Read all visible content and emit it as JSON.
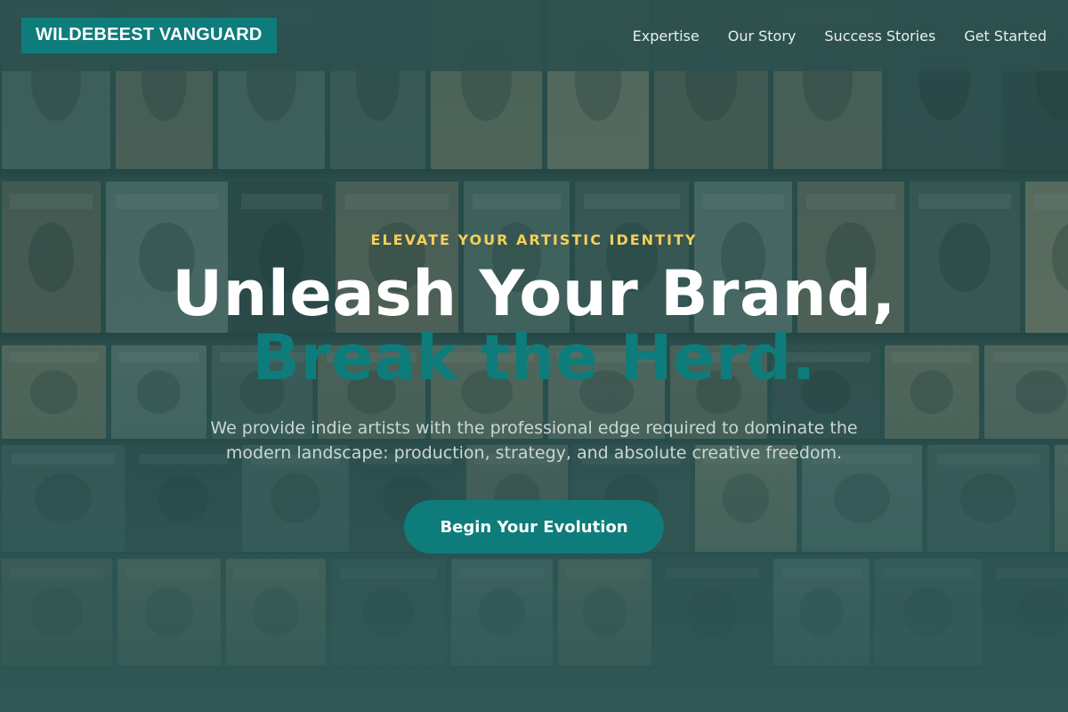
{
  "header": {
    "logo_text": "WILDEBEEST VANGUARD",
    "nav": [
      {
        "label": "Expertise"
      },
      {
        "label": "Our Story"
      },
      {
        "label": "Success Stories"
      },
      {
        "label": "Get Started"
      }
    ]
  },
  "hero": {
    "eyebrow": "ELEVATE YOUR ARTISTIC IDENTITY",
    "headline_line1": "Unleash Your Brand,",
    "headline_line2": "Break the Herd.",
    "subtitle": "We provide indie artists with the professional edge required to dominate the modern landscape: production, strategy, and absolute creative freedom.",
    "cta_label": "Begin Your Evolution"
  },
  "colors": {
    "accent": "#0e7c7b",
    "eyebrow": "#f4cf5a",
    "background": "#2e4f4f",
    "heading": "#ffffff"
  }
}
